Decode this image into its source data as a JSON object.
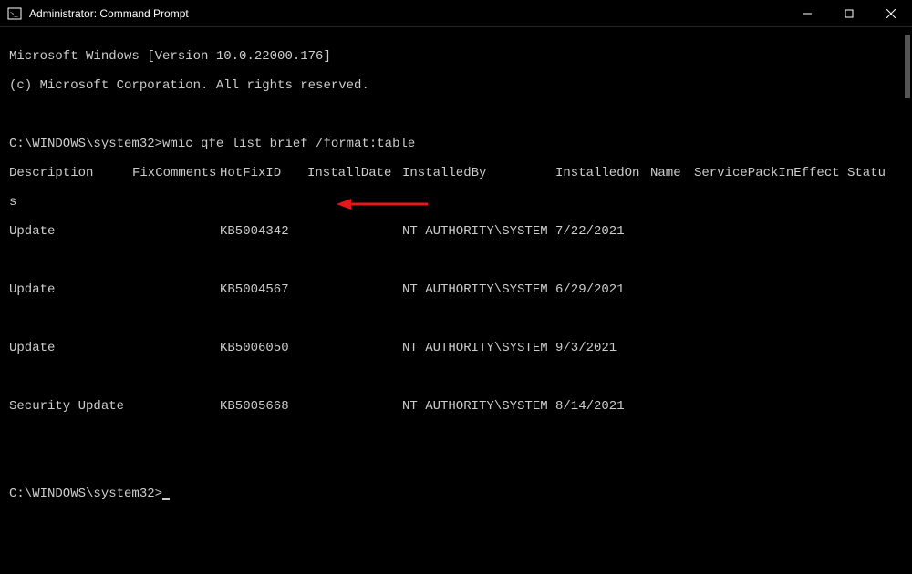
{
  "titlebar": {
    "title": "Administrator: Command Prompt"
  },
  "terminal": {
    "version_line": "Microsoft Windows [Version 10.0.22000.176]",
    "copyright_line": "(c) Microsoft Corporation. All rights reserved.",
    "prompt1": "C:\\WINDOWS\\system32>",
    "command": "wmic qfe list brief /format:table",
    "headers": {
      "description": "Description",
      "fixcomments": "FixComments",
      "hotfixid": "HotFixID",
      "installdate": "InstallDate",
      "installedby": "InstalledBy",
      "installedon": "InstalledOn",
      "name": "Name",
      "servicepack": "ServicePackInEffect",
      "status": "Statu",
      "status_wrap": "s"
    },
    "rows": [
      {
        "description": "Update",
        "hotfixid": "KB5004342",
        "installedby": "NT AUTHORITY\\SYSTEM",
        "installedon": "7/22/2021"
      },
      {
        "description": "Update",
        "hotfixid": "KB5004567",
        "installedby": "NT AUTHORITY\\SYSTEM",
        "installedon": "6/29/2021"
      },
      {
        "description": "Update",
        "hotfixid": "KB5006050",
        "installedby": "NT AUTHORITY\\SYSTEM",
        "installedon": "9/3/2021"
      },
      {
        "description": "Security Update",
        "hotfixid": "KB5005668",
        "installedby": "NT AUTHORITY\\SYSTEM",
        "installedon": "8/14/2021"
      }
    ],
    "prompt2": "C:\\WINDOWS\\system32>"
  },
  "annotation": {
    "arrow_color": "#e81717",
    "arrow_target": "KB5004567"
  }
}
